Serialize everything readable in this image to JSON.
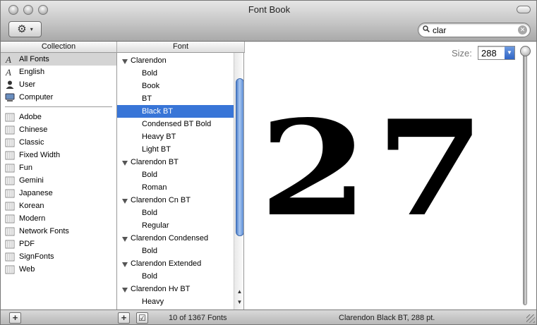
{
  "window": {
    "title": "Font Book"
  },
  "toolbar": {
    "action_icon": "gear-icon",
    "action_caret": "▾"
  },
  "search": {
    "value": "clar",
    "placeholder": ""
  },
  "collection": {
    "header": "Collection",
    "system_items": [
      {
        "label": "All Fonts",
        "icon": "font-icon",
        "selected": true
      },
      {
        "label": "English",
        "icon": "font-icon"
      },
      {
        "label": "User",
        "icon": "user-icon"
      },
      {
        "label": "Computer",
        "icon": "computer-icon"
      }
    ],
    "items": [
      {
        "label": "Adobe"
      },
      {
        "label": "Chinese"
      },
      {
        "label": "Classic"
      },
      {
        "label": "Fixed Width"
      },
      {
        "label": "Fun"
      },
      {
        "label": "Gemini"
      },
      {
        "label": "Japanese"
      },
      {
        "label": "Korean"
      },
      {
        "label": "Modern"
      },
      {
        "label": "Network Fonts"
      },
      {
        "label": "PDF"
      },
      {
        "label": "SignFonts"
      },
      {
        "label": "Web"
      }
    ]
  },
  "fonts": {
    "header": "Font",
    "rows": [
      {
        "label": "Clarendon",
        "type": "family"
      },
      {
        "label": "Bold",
        "type": "style"
      },
      {
        "label": "Book",
        "type": "style"
      },
      {
        "label": "BT",
        "type": "style"
      },
      {
        "label": "Black BT",
        "type": "style",
        "selected": true
      },
      {
        "label": "Condensed BT Bold",
        "type": "style"
      },
      {
        "label": "Heavy BT",
        "type": "style"
      },
      {
        "label": "Light BT",
        "type": "style"
      },
      {
        "label": "Clarendon BT",
        "type": "family"
      },
      {
        "label": "Bold",
        "type": "style"
      },
      {
        "label": "Roman",
        "type": "style"
      },
      {
        "label": "Clarendon Cn BT",
        "type": "family"
      },
      {
        "label": "Bold",
        "type": "style"
      },
      {
        "label": "Regular",
        "type": "style"
      },
      {
        "label": "Clarendon Condensed",
        "type": "family"
      },
      {
        "label": "Bold",
        "type": "style"
      },
      {
        "label": "Clarendon Extended",
        "type": "family"
      },
      {
        "label": "Bold",
        "type": "style"
      },
      {
        "label": "Clarendon Hv BT",
        "type": "family"
      },
      {
        "label": "Heavy",
        "type": "style"
      }
    ]
  },
  "preview": {
    "size_label": "Size:",
    "size_value": "288",
    "sample_text": "27"
  },
  "status": {
    "add_collection": "+",
    "add_font": "+",
    "enable_checkbox": "☑",
    "count": "10 of 1367 Fonts",
    "selected_font": "Clarendon Black BT, 288 pt."
  },
  "colors": {
    "selection": "#3875d7",
    "collection_selected": "#d4d4d4"
  }
}
